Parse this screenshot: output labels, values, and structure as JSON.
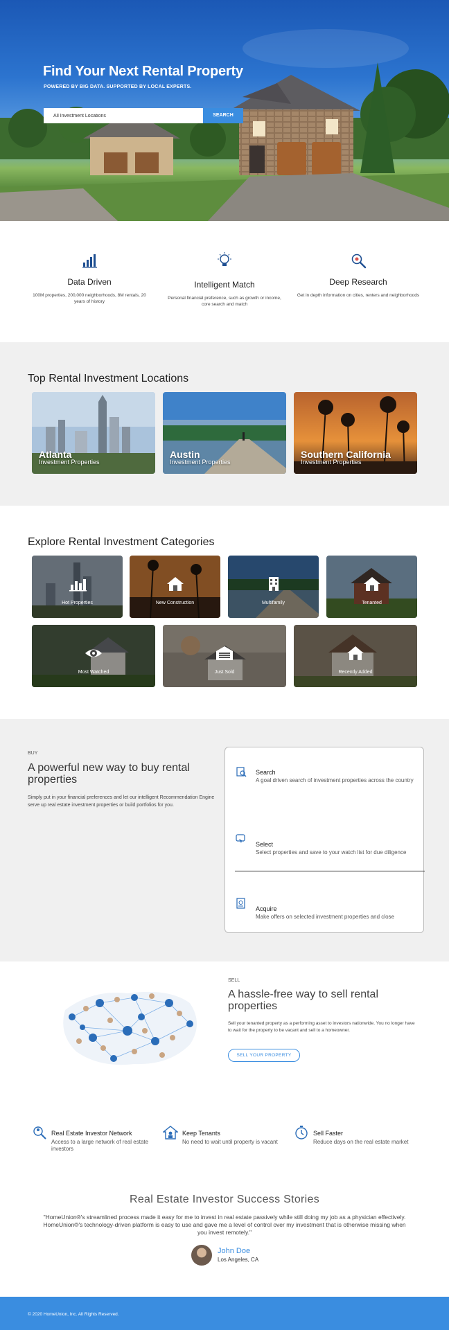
{
  "hero": {
    "title": "Find Your Next Rental Property",
    "subtitle": "POWERED BY BIG DATA. SUPPORTED BY LOCAL EXPERTS.",
    "search_value": "All Investment Locations",
    "search_button": "SEARCH"
  },
  "features": [
    {
      "title": "Data Driven",
      "desc": "100M properties, 200,000 neighborhoods, 8M rentals, 20 years of history",
      "icon": "bar-chart-icon"
    },
    {
      "title": "Intelligent Match",
      "desc": "Personal financial preference, such as growth or income, core search and match",
      "icon": "lightbulb-icon"
    },
    {
      "title": "Deep Research",
      "desc": "Get in depth information on cities, renters and neighborhoods",
      "icon": "magnifier-icon"
    }
  ],
  "top_locations": {
    "heading": "Top Rental Investment Locations",
    "items": [
      {
        "title": "Atlanta",
        "sub": "Investment Properties"
      },
      {
        "title": "Austin",
        "sub": "Investment Properties"
      },
      {
        "title": "Southern California",
        "sub": "Investment Properties"
      }
    ]
  },
  "categories": {
    "heading": "Explore Rental Investment Categories",
    "items": [
      {
        "label": "Hot Properties",
        "icon": "chart-icon"
      },
      {
        "label": "New Construction",
        "icon": "house-icon"
      },
      {
        "label": "Multifamily",
        "icon": "building-icon"
      },
      {
        "label": "Tenanted",
        "icon": "house-icon"
      },
      {
        "label": "Most Watched",
        "icon": "eye-icon"
      },
      {
        "label": "Just Sold",
        "icon": "garage-icon"
      },
      {
        "label": "Recently Added",
        "icon": "house-icon"
      }
    ]
  },
  "buy": {
    "kicker": "BUY",
    "title": "A powerful new way to buy rental properties",
    "desc": "Simply put in your financial preferences and let our intelligent Recommendation Engine serve up real estate investment properties or build portfolios for you.",
    "steps": [
      {
        "title": "Search",
        "desc": "A goal driven search of investment properties across the country"
      },
      {
        "title": "Select",
        "desc": "Select properties and save to your watch list for due diligence"
      },
      {
        "title": "Acquire",
        "desc": "Make offers on selected investment properties and close"
      }
    ]
  },
  "sell": {
    "kicker": "SELL",
    "title": "A hassle-free way to sell rental properties",
    "desc": "Sell your tenanted property as a performing asset to investors nationwide. You no longer have to wait for the property to be vacant and sell to a homeowner.",
    "button": "SELL YOUR PROPERTY"
  },
  "benefits": [
    {
      "title": "Real Estate Investor Network",
      "desc": "Access to a large network of real estate investors",
      "icon": "network-icon"
    },
    {
      "title": "Keep Tenants",
      "desc": "No need to wait until property is vacant",
      "icon": "house-person-icon"
    },
    {
      "title": "Sell Faster",
      "desc": "Reduce days on the real estate market",
      "icon": "stopwatch-icon"
    }
  ],
  "stories": {
    "heading": "Real Estate Investor Success Stories",
    "quote": "\"HomeUnion®'s streamlined process made it easy for me to invest in real estate passively while still doing my job as a physician effectively. HomeUnion®'s technology-driven platform is easy to use and gave me a level of control over my investment that is otherwise missing when you invest remotely.\"",
    "name": "John Doe",
    "location": "Los Angeles, CA"
  },
  "footer": {
    "text": "© 2020 HomeUnion, Inc. All Rights Reserved."
  },
  "colors": {
    "accent": "#3a8de0",
    "section_grey": "#f0f0f0"
  }
}
